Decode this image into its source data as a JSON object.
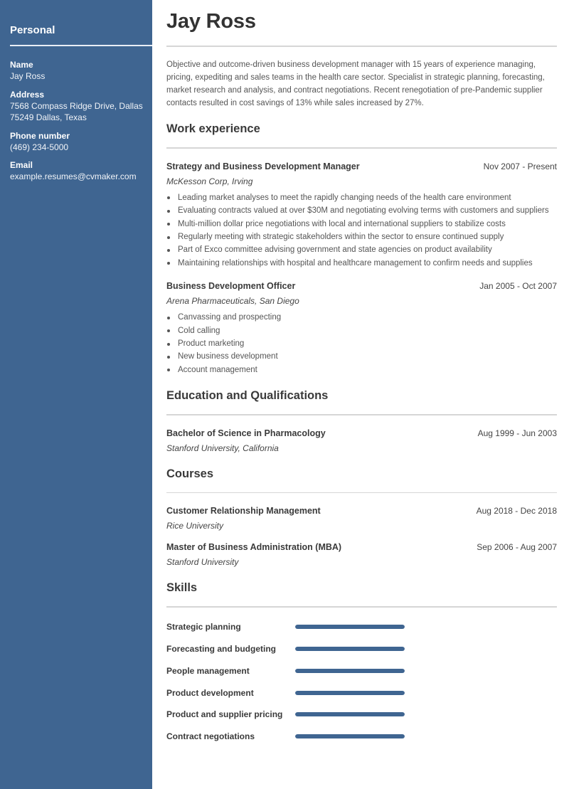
{
  "sidebar": {
    "title": "Personal",
    "fields": [
      {
        "label": "Name",
        "lines": [
          "Jay Ross"
        ]
      },
      {
        "label": "Address",
        "lines": [
          "7568 Compass Ridge Drive, Dallas",
          "75249 Dallas, Texas"
        ]
      },
      {
        "label": "Phone number",
        "lines": [
          "(469) 234-5000"
        ]
      },
      {
        "label": "Email",
        "lines": [
          "example.resumes@cvmaker.com"
        ]
      }
    ]
  },
  "header": {
    "name": "Jay Ross",
    "summary": "Objective and outcome-driven business development manager with 15 years of experience managing, pricing, expediting and sales teams in the health care sector. Specialist in strategic planning, forecasting, market research and analysis, and contract negotiations. Recent renegotiation of pre-Pandemic supplier contacts resulted in cost savings of 13% while sales increased by 27%."
  },
  "work": {
    "title": "Work experience",
    "entries": [
      {
        "title": "Strategy and Business Development Manager",
        "date": "Nov 2007 - Present",
        "org": "McKesson Corp, Irving",
        "bullets": [
          "Leading market analyses to meet the rapidly changing needs of the health care environment",
          "Evaluating contracts valued at over $30M and negotiating evolving terms with customers and suppliers",
          "Multi-million dollar price negotiations with local and international suppliers to stabilize costs",
          "Regularly meeting with strategic stakeholders within the sector to ensure continued supply",
          "Part of Exco committee advising government and state agencies on product availability",
          "Maintaining relationships with hospital and healthcare management to confirm needs and supplies"
        ]
      },
      {
        "title": "Business Development Officer",
        "date": "Jan 2005 - Oct 2007",
        "org": "Arena Pharmaceuticals, San Diego",
        "bullets": [
          "Canvassing and prospecting",
          "Cold calling",
          "Product marketing",
          "New business development",
          "Account management"
        ]
      }
    ]
  },
  "education": {
    "title": "Education and Qualifications",
    "entries": [
      {
        "title": "Bachelor of Science in Pharmacology",
        "date": "Aug 1999 - Jun 2003",
        "org": "Stanford University, California"
      }
    ]
  },
  "courses": {
    "title": "Courses",
    "entries": [
      {
        "title": "Customer Relationship Management",
        "date": "Aug 2018 - Dec 2018",
        "org": "Rice University"
      },
      {
        "title": "Master of Business Administration (MBA)",
        "date": "Sep 2006 - Aug 2007",
        "org": "Stanford University"
      }
    ]
  },
  "skills": {
    "title": "Skills",
    "items": [
      {
        "name": "Strategic planning",
        "level": 1.0
      },
      {
        "name": "Forecasting and budgeting",
        "level": 1.0
      },
      {
        "name": "People management",
        "level": 1.0
      },
      {
        "name": "Product development",
        "level": 1.0
      },
      {
        "name": "Product and supplier pricing",
        "level": 1.0
      },
      {
        "name": "Contract negotiations",
        "level": 1.0
      }
    ]
  },
  "colors": {
    "accent": "#3f6591",
    "rule": "#d6d6d6",
    "text": "#3a3a3a"
  }
}
